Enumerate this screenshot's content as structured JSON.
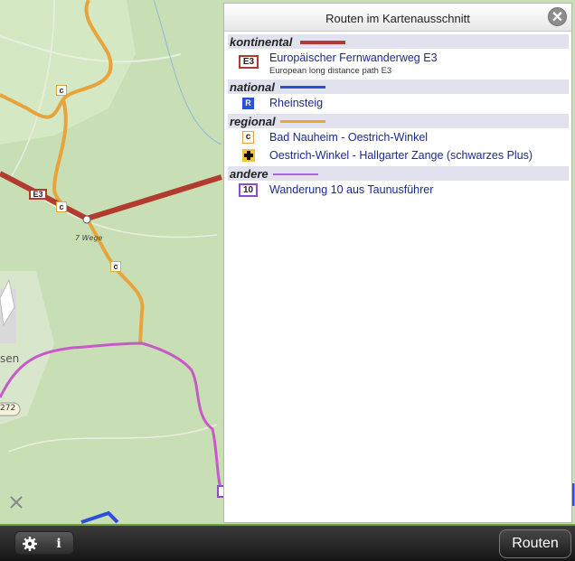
{
  "map": {
    "labels": {
      "junction": "7 Wege",
      "place": "sen",
      "road_ref": "272"
    },
    "markers": {
      "e3": "E3",
      "regional": "c"
    },
    "colors": {
      "forest": "#c6dfb4",
      "meadow": "#cfe4c0",
      "kontinental": "#b23a2e",
      "regional": "#e8a43c",
      "andere": "#c85ac8",
      "national": "#2a4fd8"
    }
  },
  "panel": {
    "title": "Routen im Kartenausschnitt",
    "close_icon": "close-icon",
    "categories": [
      {
        "name": "kontinental",
        "color": "#b23a2e",
        "routes": [
          {
            "symbol": "E3",
            "symbol_style": "e3-box",
            "name": "Europäischer Fernwanderweg E3",
            "subtitle": "European long distance path E3"
          }
        ]
      },
      {
        "name": "national",
        "color": "#2a4fd8",
        "routes": [
          {
            "symbol": "R",
            "symbol_style": "blue-square",
            "name": "Rheinsteig"
          }
        ]
      },
      {
        "name": "regional",
        "color": "#f0a03c",
        "routes": [
          {
            "symbol": "c",
            "symbol_style": "orange-box",
            "name": "Bad Nauheim - Oestrich-Winkel"
          },
          {
            "symbol": "cross-icon",
            "symbol_style": "black-plus",
            "name": "Oestrich-Winkel - Hallgarter Zange (schwarzes Plus)"
          }
        ]
      },
      {
        "name": "andere",
        "color": "#b060e0",
        "routes": [
          {
            "symbol": "10",
            "symbol_style": "purple-box",
            "name": "Wanderung 10 aus Taunusführer"
          }
        ]
      }
    ]
  },
  "toolbar": {
    "settings_icon": "gear-icon",
    "info_icon": "info-icon",
    "info_glyph": "i",
    "routes_label": "Routen"
  }
}
